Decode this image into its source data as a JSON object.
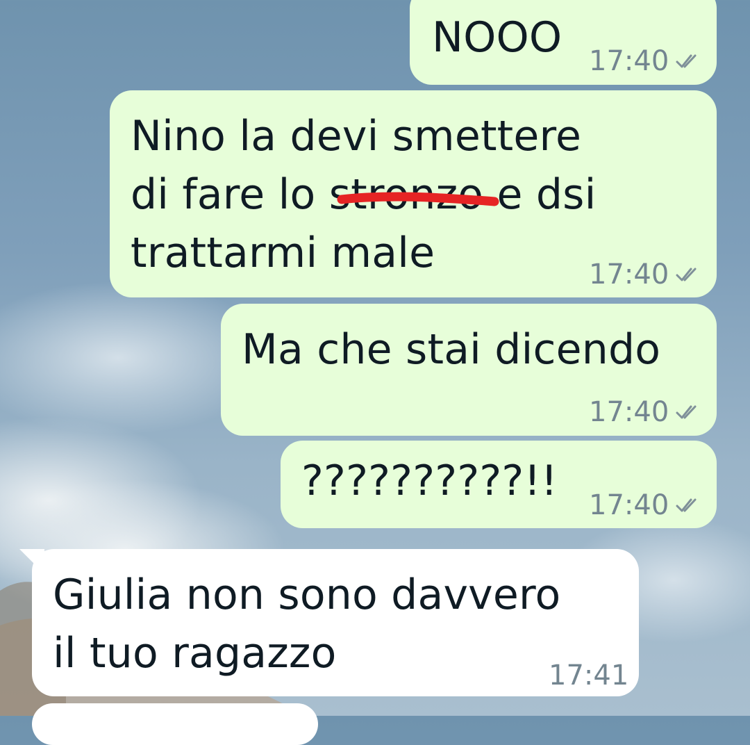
{
  "colors": {
    "outgoing_bubble": "#e7fed9",
    "incoming_bubble": "#ffffff",
    "text": "#0f1b24",
    "meta_text": "#738590",
    "strike_mark": "#e62424"
  },
  "messages": [
    {
      "direction": "outgoing",
      "lines": [
        "NOOO"
      ],
      "time": "17:40",
      "status": "double-check-icon"
    },
    {
      "direction": "outgoing",
      "lines": [
        "Nino la devi smettere",
        "di fare lo stronzo e dsi",
        "trattarmi male"
      ],
      "time": "17:40",
      "status": "double-check-icon",
      "redacted_word": "stronzo"
    },
    {
      "direction": "outgoing",
      "lines": [
        "Ma che stai dicendo"
      ],
      "time": "17:40",
      "status": "double-check-icon"
    },
    {
      "direction": "outgoing",
      "lines": [
        "??????????!!"
      ],
      "time": "17:40",
      "status": "double-check-icon"
    },
    {
      "direction": "incoming",
      "lines": [
        "Giulia non sono davvero",
        "il tuo ragazzo"
      ],
      "time": "17:41"
    }
  ]
}
